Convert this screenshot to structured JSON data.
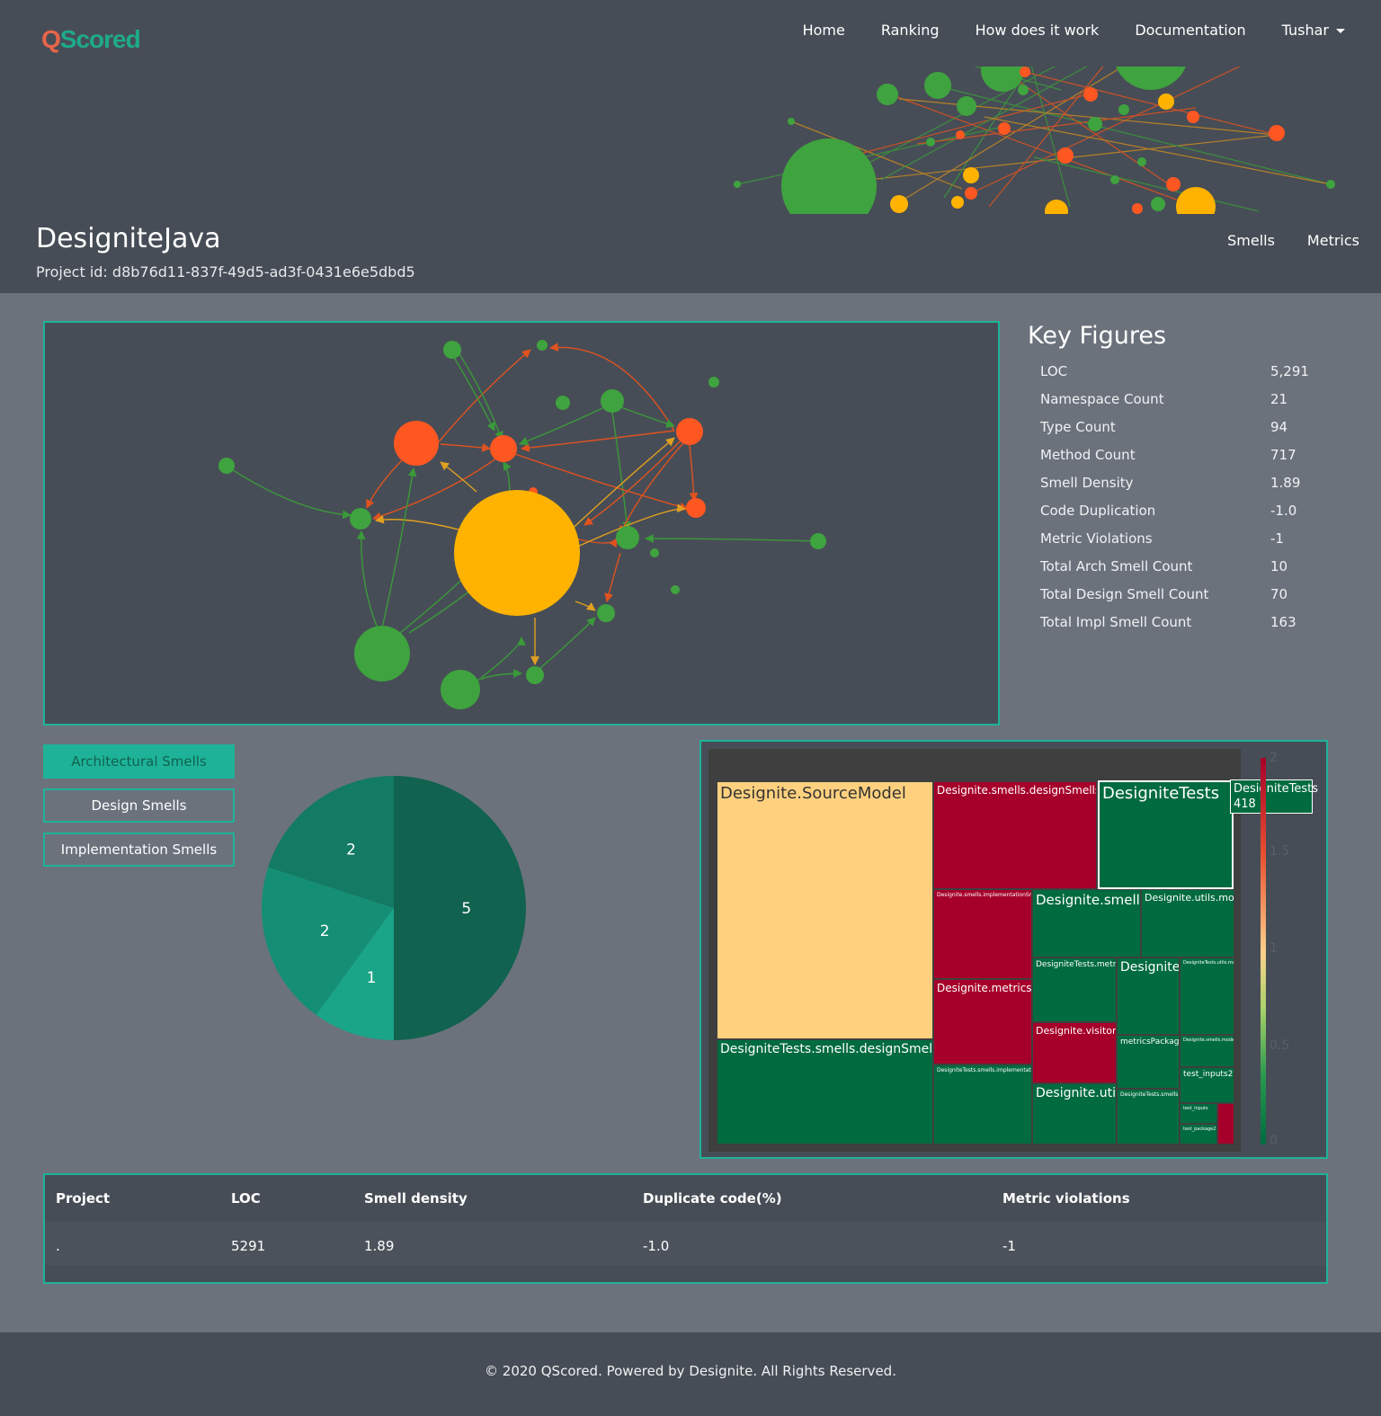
{
  "nav": {
    "logo_q": "Q",
    "logo_rest": "Scored",
    "links": [
      "Home",
      "Ranking",
      "How does it work",
      "Documentation"
    ],
    "user": "Tushar"
  },
  "project": {
    "title": "DesigniteJava",
    "id_text": "Project id: d8b76d11-837f-49d5-ad3f-0431e6e5dbd5",
    "tabs": [
      "Smells",
      "Metrics"
    ]
  },
  "key_figures": {
    "heading": "Key Figures",
    "rows": [
      {
        "label": "LOC",
        "value": "5,291"
      },
      {
        "label": "Namespace Count",
        "value": "21"
      },
      {
        "label": "Type Count",
        "value": "94"
      },
      {
        "label": "Method Count",
        "value": "717"
      },
      {
        "label": "Smell Density",
        "value": "1.89"
      },
      {
        "label": "Code Duplication",
        "value": "-1.0"
      },
      {
        "label": "Metric Violations",
        "value": "-1"
      },
      {
        "label": "Total Arch Smell Count",
        "value": "10"
      },
      {
        "label": "Total Design Smell Count",
        "value": "70"
      },
      {
        "label": "Total Impl Smell Count",
        "value": "163"
      }
    ]
  },
  "smell_buttons": [
    "Architectural Smells",
    "Design Smells",
    "Implementation Smells"
  ],
  "chart_data": {
    "type": "pie",
    "values": [
      5,
      1,
      2,
      2
    ],
    "colors": [
      "#11624f",
      "#1aa588",
      "#148f75",
      "#137a63"
    ]
  },
  "treemap": {
    "cells": [
      {
        "label": "Designite.SourceModel",
        "size": "big"
      },
      {
        "label": "DesigniteTests.smells.designSmells",
        "size": "mid"
      },
      {
        "label": "Designite.smells.designSmells",
        "size": "sm"
      },
      {
        "label": "DesigniteTests",
        "size": "mid"
      },
      {
        "label": "Designite.smells.implementationSmells",
        "size": "xs"
      },
      {
        "label": "Designite.smells",
        "size": "mid2"
      },
      {
        "label": "Designite.utils.models",
        "size": "sm2"
      },
      {
        "label": "DesigniteTests.metrics",
        "size": "xs2"
      },
      {
        "label": "Designite",
        "size": "mid2"
      },
      {
        "label": "DesigniteTests.utils.models",
        "size": "xs"
      },
      {
        "label": "Designite.metrics",
        "size": "sm"
      },
      {
        "label": "Designite.visitors",
        "size": "sm2"
      },
      {
        "label": "metricsPackage",
        "size": "xs2"
      },
      {
        "label": "Designite.smells.models",
        "size": "xs"
      },
      {
        "label": "DesigniteTests.smells.implementationSmells",
        "size": "xs"
      },
      {
        "label": "Designite.utils",
        "size": "mid3"
      },
      {
        "label": "DesigniteTests.smells",
        "size": "xs"
      },
      {
        "label": "test_inputs2",
        "size": "xs2"
      },
      {
        "label": "test_inputs",
        "size": "xs"
      },
      {
        "label": "test_package2",
        "size": "xs"
      }
    ],
    "tooltip_name": "DesigniteTests",
    "tooltip_value": "418",
    "scale_ticks": [
      "2",
      "1.5",
      "1",
      "0.5",
      "0"
    ]
  },
  "summary_table": {
    "headers": [
      "Project",
      "LOC",
      "Smell density",
      "Duplicate code(%)",
      "Metric violations"
    ],
    "row": [
      ".",
      "5291",
      "1.89",
      "-1.0",
      "-1"
    ]
  },
  "footer": "© 2020 QScored. Powered by Designite. All Rights Reserved."
}
